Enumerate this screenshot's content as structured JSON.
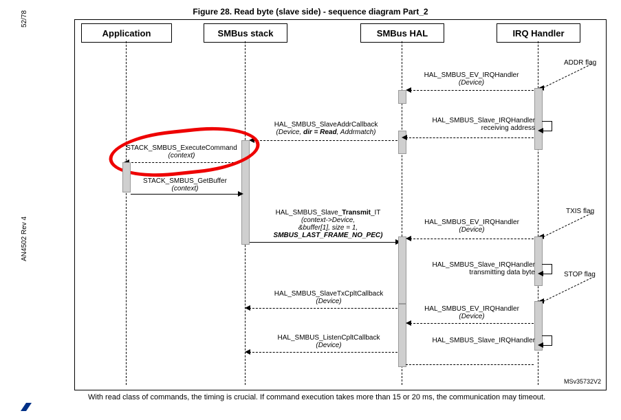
{
  "page_meta": {
    "page_num": "52/78",
    "doc_id": "AN4502 Rev 4"
  },
  "figure_title": "Figure 28. Read byte (slave side) - sequence diagram Part_2",
  "lanes": {
    "app": "Application",
    "stack": "SMBus stack",
    "hal": "SMBus HAL",
    "irq": "IRQ Handler"
  },
  "ext": {
    "addr": "ADDR flag",
    "txis": "TXIS flag",
    "stop": "STOP flag"
  },
  "msg": {
    "ev_irq1": {
      "name": "HAL_SMBUS_EV_IRQHandler",
      "arg": "(Device)"
    },
    "slave_irq_addr": {
      "name": "HAL_SMBUS_Slave_IRQHandler",
      "sub": "receiving address"
    },
    "slave_addr_cb": {
      "name": "HAL_SMBUS_SlaveAddrCallback",
      "arg_pre": "(Device, ",
      "arg_bold": "dir = Read",
      "arg_post": ", Addrmatch)"
    },
    "exec_cmd": {
      "name": "STACK_SMBUS_ExecuteCommand",
      "arg": "(context)"
    },
    "get_buf": {
      "name": "STACK_SMBUS_GetBuffer",
      "arg": "(context)"
    },
    "slave_tx_it": {
      "name_pre": "HAL_SMBUS_Slave_",
      "name_bold": "Transmit",
      "name_post": "_IT",
      "arg1": "(context->Device,",
      "arg2": "&buffer[1], size = 1,",
      "arg3": "SMBUS_LAST_FRAME_NO_PEC)"
    },
    "ev_irq2": {
      "name": "HAL_SMBUS_EV_IRQHandler",
      "arg": "(Device)"
    },
    "slave_irq_tx": {
      "name": "HAL_SMBUS_Slave_IRQHandler",
      "sub": "transmitting data byte"
    },
    "txcplt": {
      "name": "HAL_SMBUS_SlaveTxCpltCallback",
      "arg": "(Device)"
    },
    "ev_irq3": {
      "name": "HAL_SMBUS_EV_IRQHandler",
      "arg": "(Device)"
    },
    "slave_irq3": {
      "name": "HAL_SMBUS_Slave_IRQHandler"
    },
    "listen_cplt": {
      "name": "HAL_SMBUS_ListenCpltCallback",
      "arg": "(Device)"
    }
  },
  "footer_id": "MSv35732V2",
  "caption": "With read class of commands, the timing is crucial. If command execution takes more than 15 or 20 ms, the communication may timeout."
}
